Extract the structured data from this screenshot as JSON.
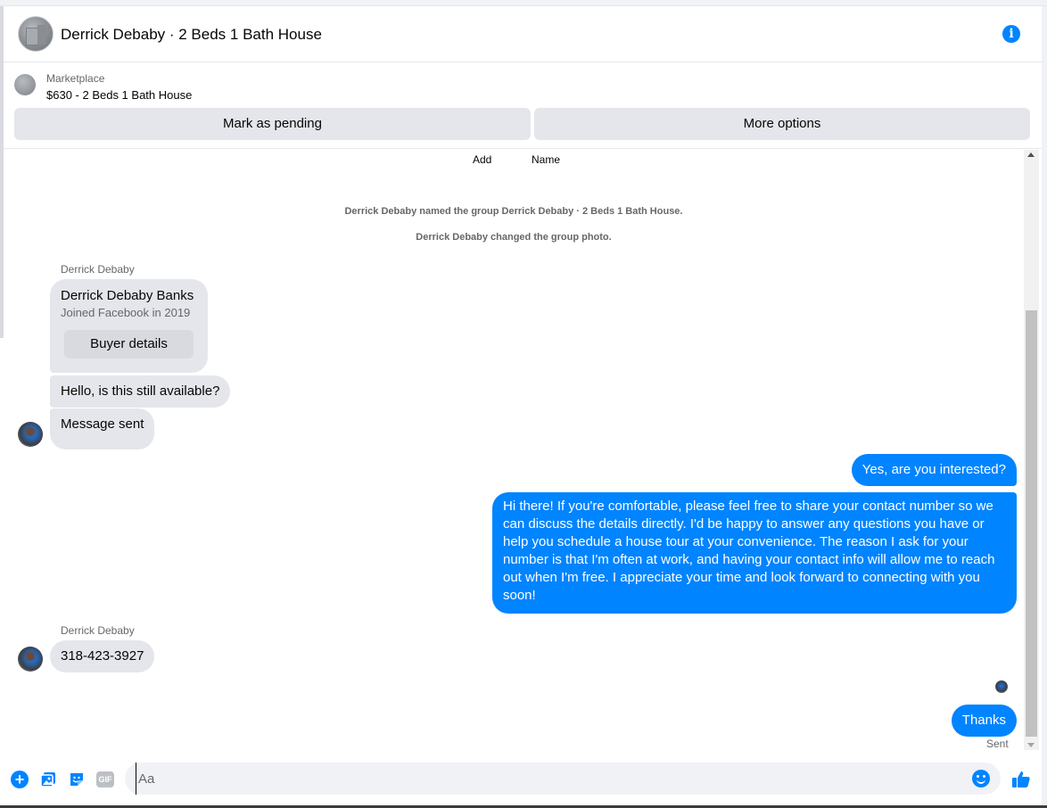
{
  "header": {
    "title": "Derrick Debaby · 2 Beds 1 Bath House",
    "info_icon": "i"
  },
  "marketplace": {
    "label": "Marketplace",
    "item": "$630 - 2 Beds 1 Bath House",
    "mark_pending_label": "Mark as pending",
    "more_options_label": "More options"
  },
  "thread": {
    "add_label": "Add",
    "name_label": "Name",
    "system_messages": [
      "Derrick Debaby named the group Derrick Debaby · 2 Beds 1 Bath House.",
      "Derrick Debaby changed the group photo."
    ],
    "buyer_card": {
      "sender": "Derrick Debaby",
      "name": "Derrick Debaby Banks",
      "joined": "Joined Facebook in 2019",
      "button_label": "Buyer details"
    },
    "incoming_1": "Hello, is this still available?",
    "incoming_2": "Message sent",
    "outgoing_1": "Yes, are you interested?",
    "outgoing_2": "Hi there! If you're comfortable, please feel free to share your contact number so we can discuss the details directly. I'd be happy to answer any questions you have or help you schedule a house tour at your convenience. The reason I ask for your number is that I'm often at work, and having your contact info will allow me to reach out when I'm free. I appreciate your time and look forward to connecting with you soon!",
    "incoming_sender_2": "Derrick Debaby",
    "incoming_3": "318-423-3927",
    "outgoing_3": "Thanks",
    "sent_status": "Sent"
  },
  "composer": {
    "placeholder": "Aa",
    "gif_label": "GIF",
    "plus_label": "+"
  },
  "colors": {
    "accent": "#0084ff",
    "incoming_bubble": "#e4e6eb"
  }
}
